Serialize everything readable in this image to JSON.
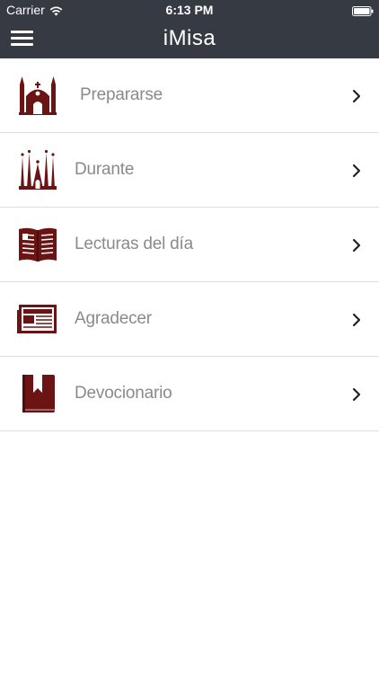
{
  "status_bar": {
    "carrier": "Carrier",
    "time": "6:13 PM",
    "wifi_icon": "wifi-icon",
    "battery_icon": "battery-icon"
  },
  "navbar": {
    "title": "iMisa",
    "menu_icon": "hamburger-menu-icon",
    "background_color": "#363a43"
  },
  "menu": {
    "icon_color": "#6b1414",
    "items": [
      {
        "label": "Prepararse",
        "icon": "church-icon"
      },
      {
        "label": "Durante",
        "icon": "cathedral-spires-icon"
      },
      {
        "label": "Lecturas del día",
        "icon": "open-book-icon"
      },
      {
        "label": "Agradecer",
        "icon": "newspaper-icon"
      },
      {
        "label": "Devocionario",
        "icon": "bookmarked-book-icon"
      }
    ]
  }
}
